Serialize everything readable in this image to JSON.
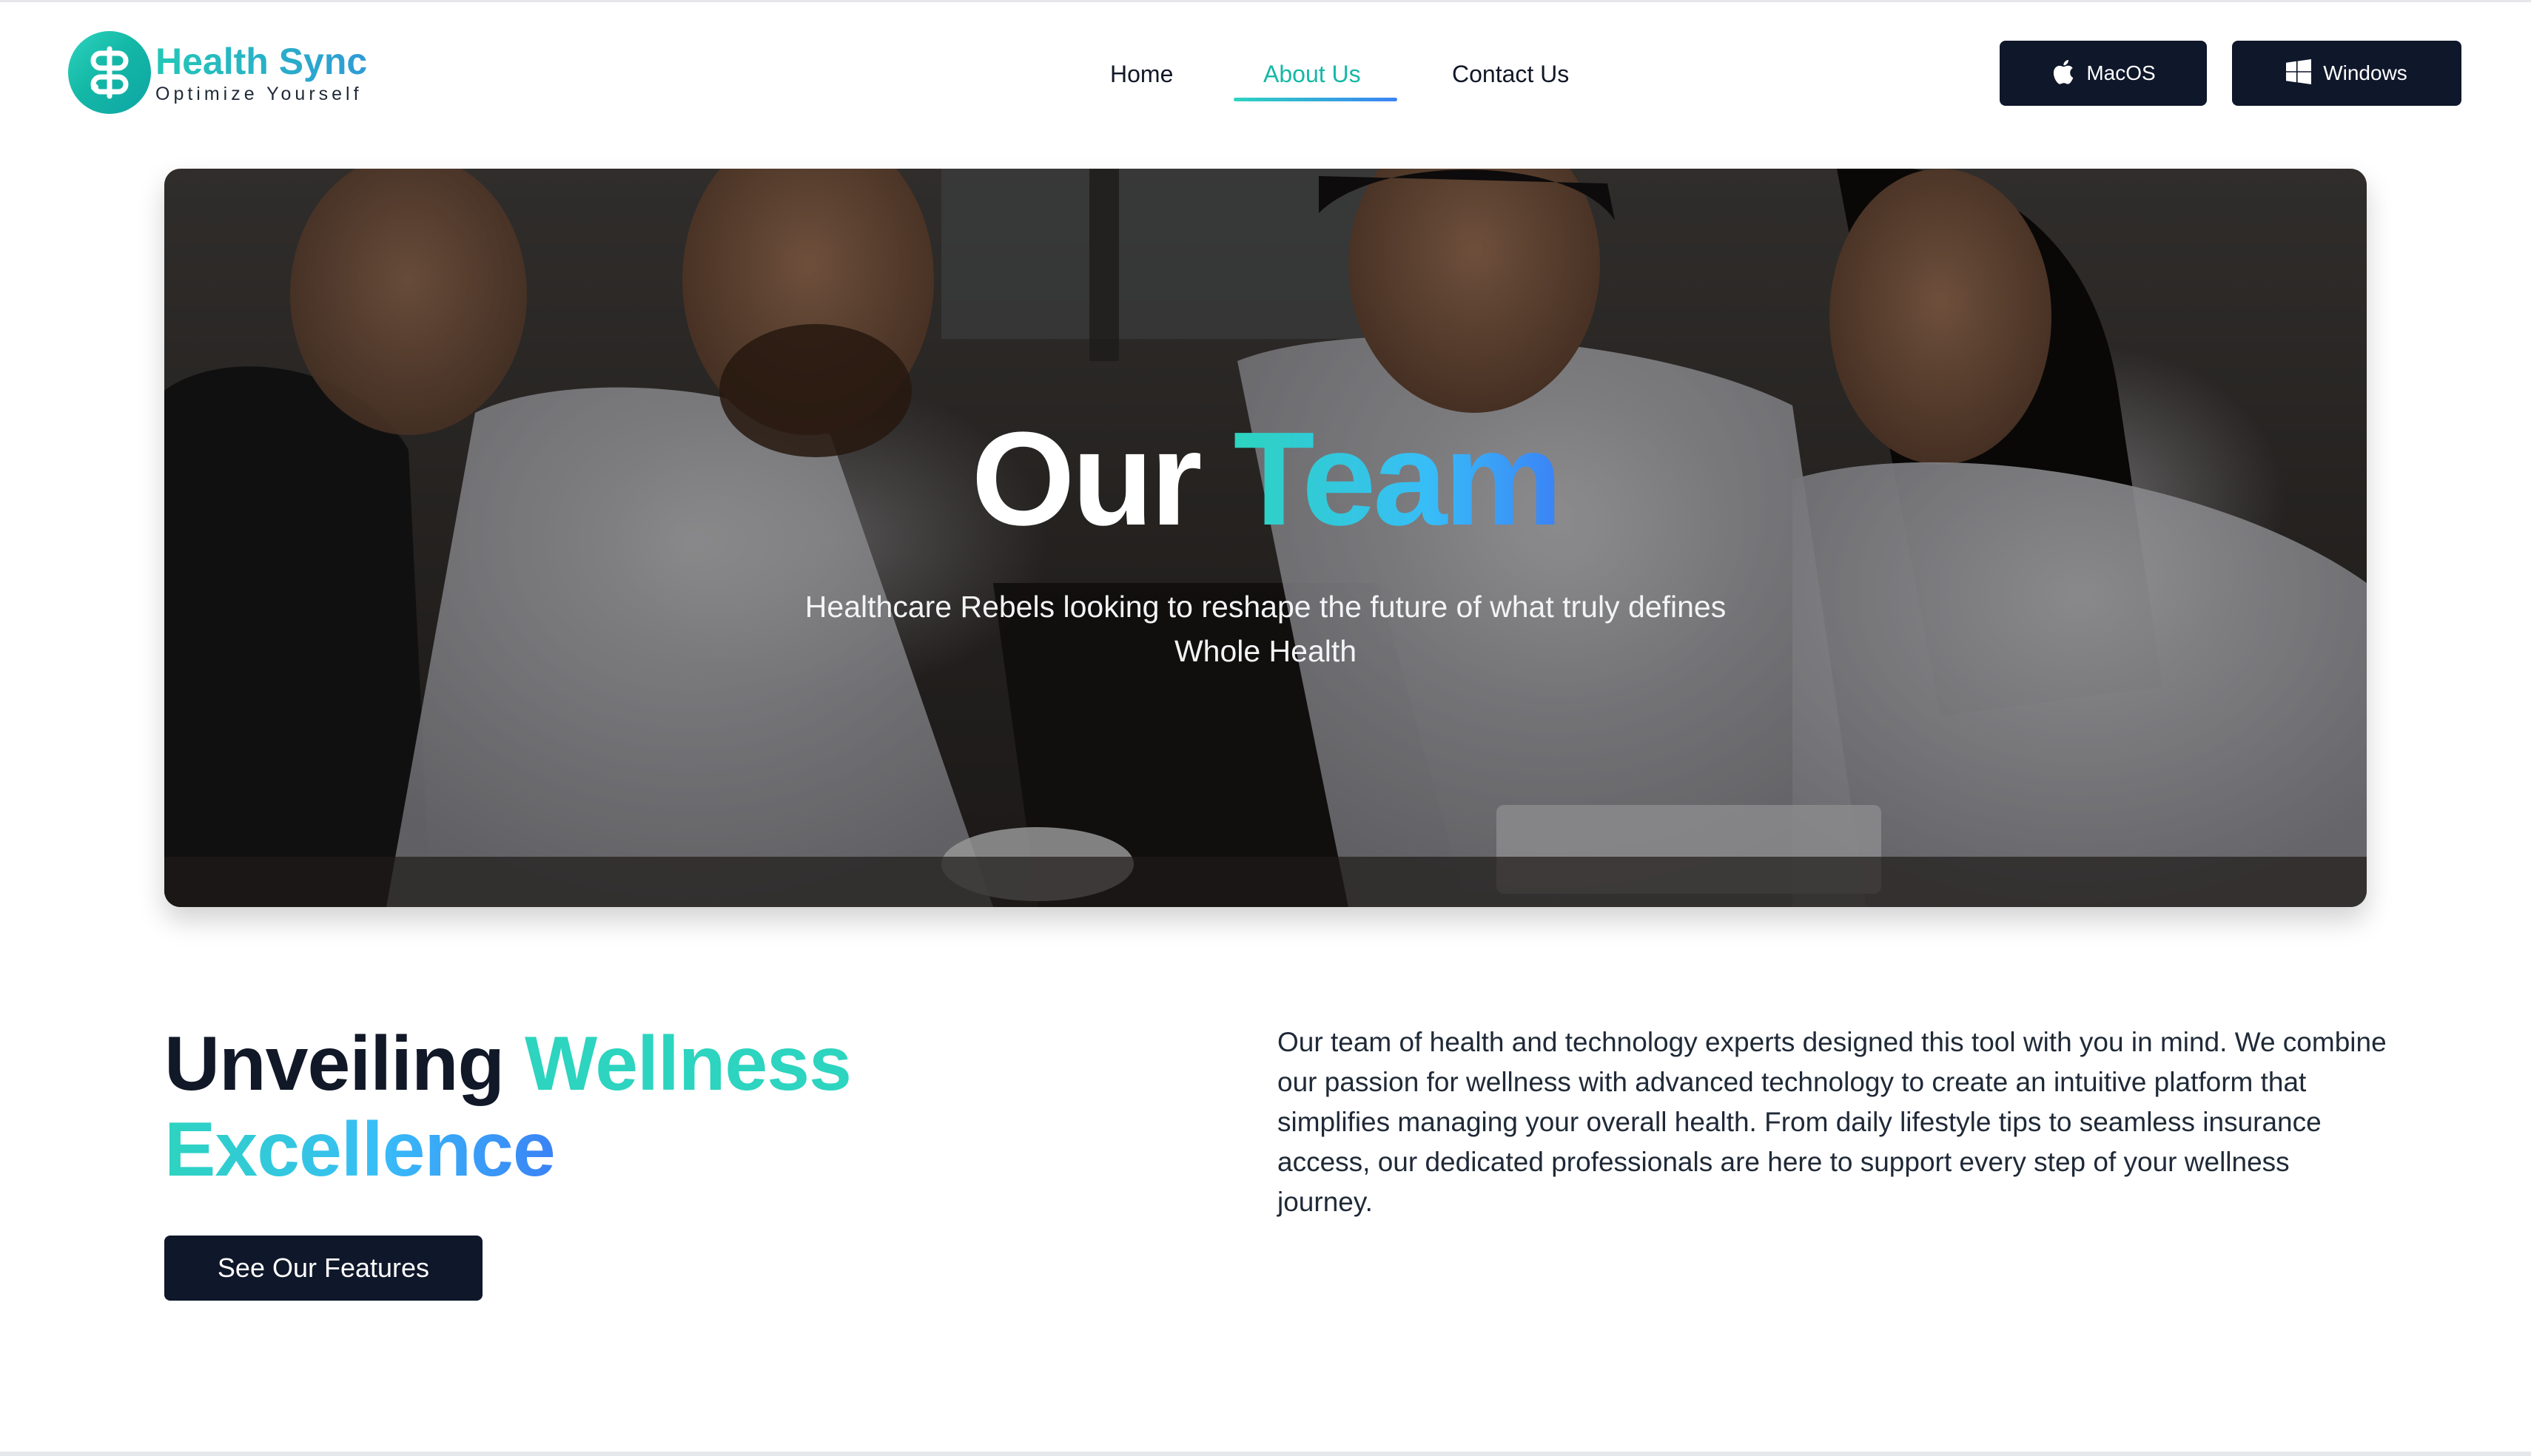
{
  "brand": {
    "title": "Health Sync",
    "subtitle": "Optimize Yourself",
    "accent": "#14b8a6",
    "accent_gradient": [
      "#2dd4bf",
      "#3b82f6"
    ],
    "dark": "#0f172a"
  },
  "nav": {
    "items": [
      {
        "label": "Home",
        "active": false
      },
      {
        "label": "About Us",
        "active": true
      },
      {
        "label": "Contact Us",
        "active": false
      }
    ]
  },
  "downloads": {
    "mac": {
      "label": "MacOS",
      "icon": "apple-icon"
    },
    "windows": {
      "label": "Windows",
      "icon": "windows-icon"
    }
  },
  "hero": {
    "title_part1": "Our",
    "title_part2": "Team",
    "subtitle": "Healthcare Rebels looking to reshape the future of what truly defines Whole Health"
  },
  "intro": {
    "heading_part1": "Unveiling",
    "heading_part2": "Wellness",
    "heading_part3": "Excellence",
    "button_label": "See Our Features",
    "paragraph": "Our team of health and technology experts designed this tool with you in mind. We combine our passion for wellness with advanced technology to create an intuitive platform that simplifies managing your overall health. From daily lifestyle tips to seamless insurance access, our dedicated professionals are here to support every step of your wellness journey."
  }
}
